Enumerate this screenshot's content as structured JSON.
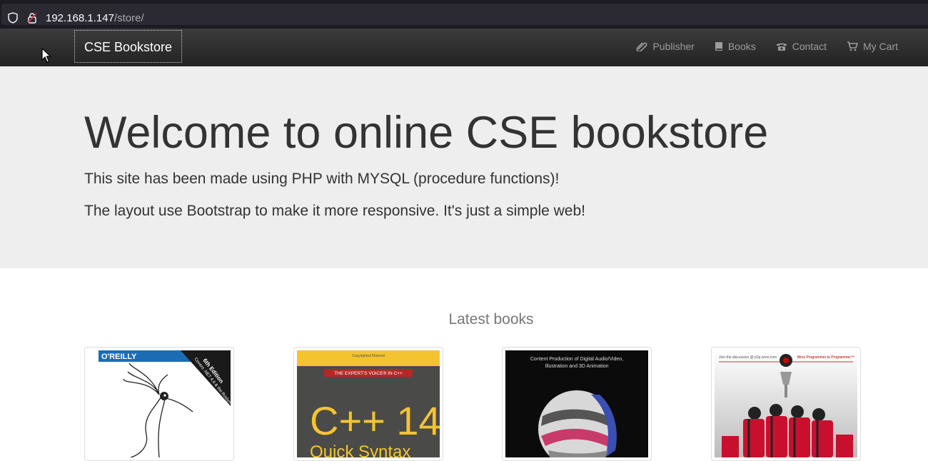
{
  "browser": {
    "url_host": "192.168.1.147",
    "url_path": "/store/"
  },
  "navbar": {
    "brand": "CSE Bookstore",
    "items": [
      {
        "label": "Publisher",
        "icon": "paperclip-icon"
      },
      {
        "label": "Books",
        "icon": "book-icon"
      },
      {
        "label": "Contact",
        "icon": "phone-icon"
      },
      {
        "label": "My Cart",
        "icon": "cart-icon"
      }
    ]
  },
  "jumbotron": {
    "heading": "Welcome to online CSE bookstore",
    "line1": "This site has been made using PHP with MYSQL (procedure functions)!",
    "line2": "The layout use Bootstrap to make it more responsive. It's just a simple web!"
  },
  "latest": {
    "title": "Latest books",
    "books": [
      {
        "publisher": "O'REILLY",
        "edition": "6th Edition",
        "edition_note": "Covers .NET 4.6 & the Roslyn Compiler"
      },
      {
        "series": "THE EXPERT'S VOICE® IN C++",
        "title_line1": "C++ 14",
        "title_line2": "Quick Syntax",
        "top_note": "Copyrighted Material"
      },
      {
        "subtitle": "Content Production of Digital Audio/Video, Illustration and 3D Animation"
      },
      {
        "left_note": "Join the discussion @ p2p.wrox.com",
        "right_note": "Wrox Programmer to Programmer™"
      }
    ]
  }
}
